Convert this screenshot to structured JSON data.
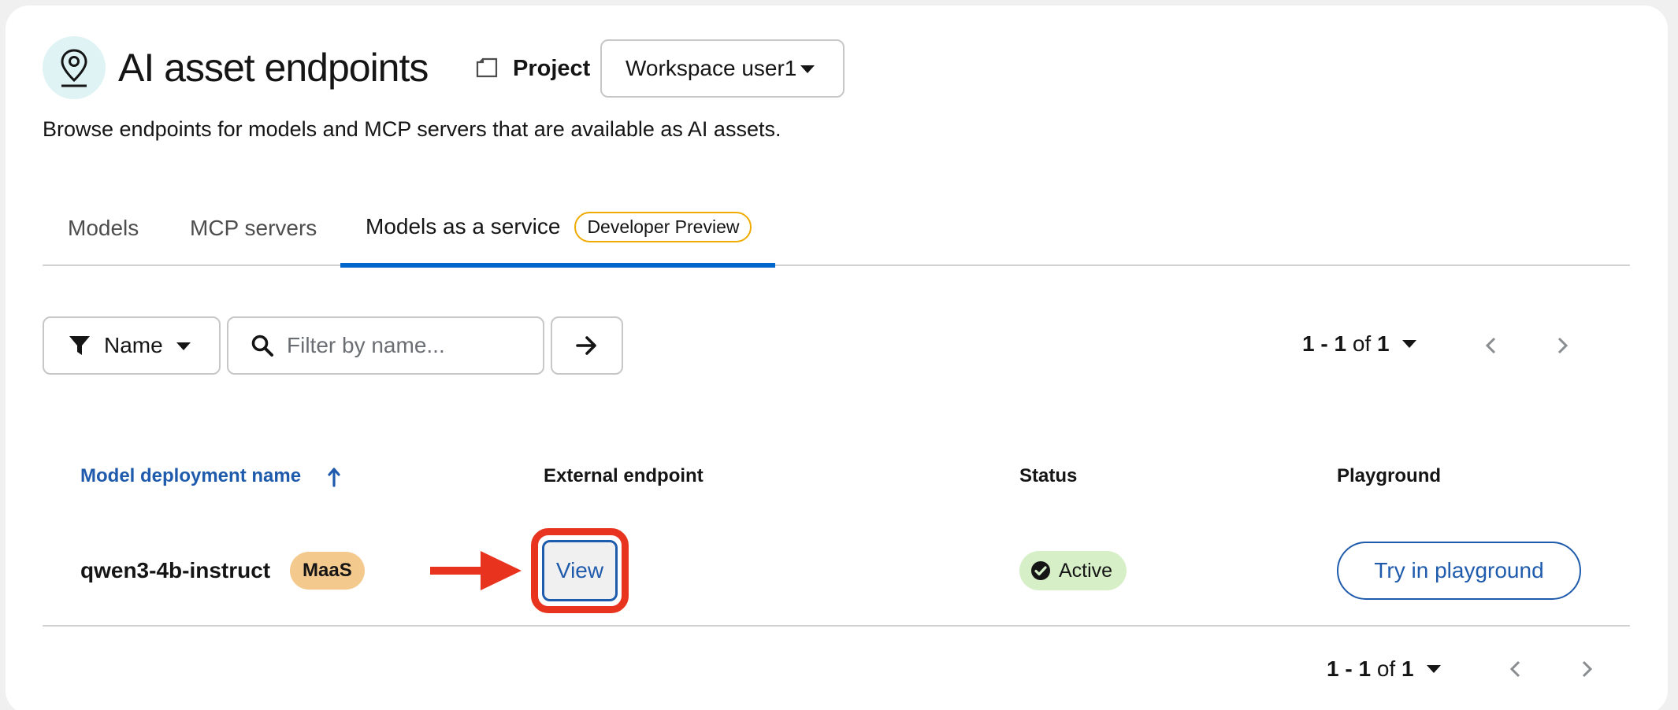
{
  "header": {
    "title": "AI asset endpoints",
    "project_label": "Project",
    "workspace_selected": "Workspace user1",
    "description": "Browse endpoints for models and MCP servers that are available as AI assets."
  },
  "tabs": [
    {
      "label": "Models"
    },
    {
      "label": "MCP servers"
    },
    {
      "label": "Models as a service",
      "badge": "Developer Preview",
      "active": true
    }
  ],
  "toolbar": {
    "filter_label": "Name",
    "search_placeholder": "Filter by name...",
    "pagination": {
      "range": "1 - 1",
      "of": "of",
      "total": "1"
    }
  },
  "table": {
    "columns": [
      "Model deployment name",
      "External endpoint",
      "Status",
      "Playground"
    ],
    "sorted_column": "Model deployment name",
    "rows": [
      {
        "name": "qwen3-4b-instruct",
        "badge": "MaaS",
        "endpoint_action": "View",
        "status": "Active",
        "playground_action": "Try in playground"
      }
    ]
  },
  "colors": {
    "accent": "#0066cc",
    "link": "#1f5bac",
    "annotation": "#e8331f",
    "status_active_bg": "#d6efc7",
    "maas_badge_bg": "#f4c98d",
    "preview_badge_border": "#f0ab00"
  }
}
